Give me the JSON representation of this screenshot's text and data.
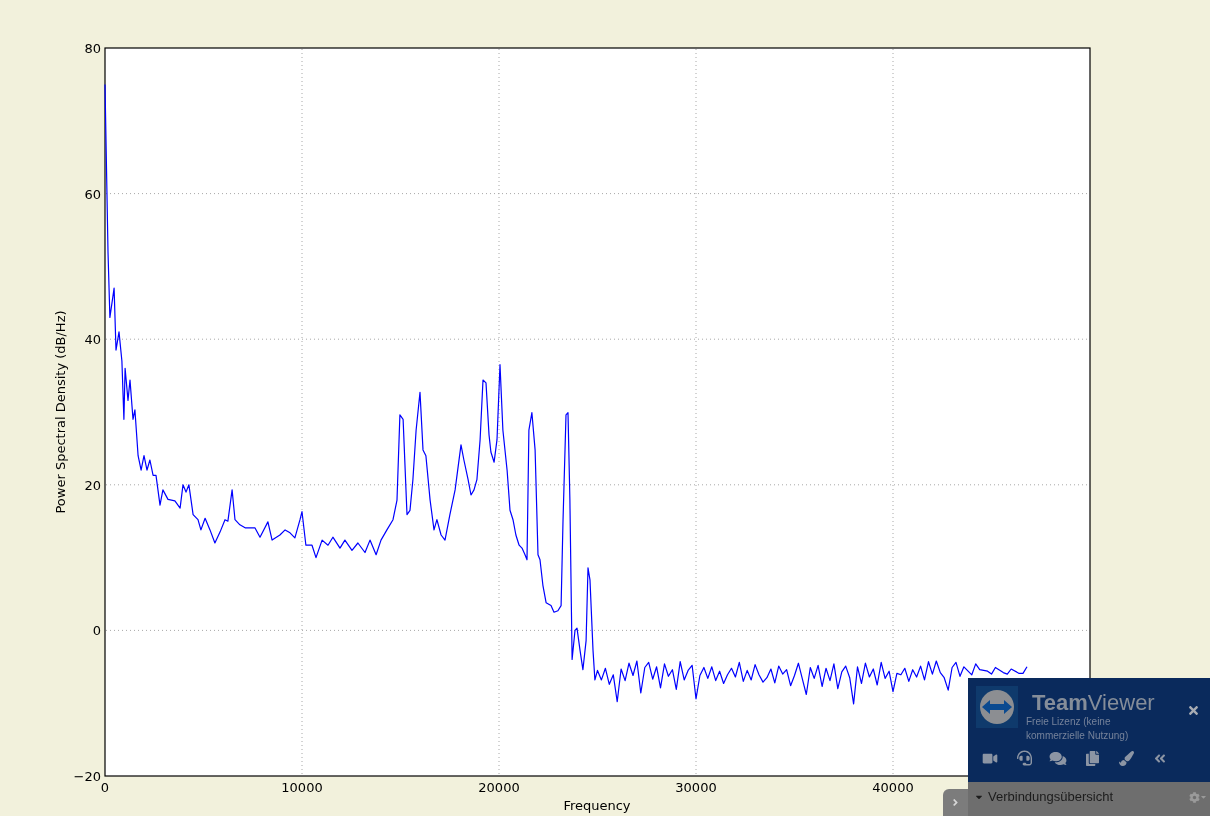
{
  "chart": {
    "chart_data": {
      "type": "line",
      "grid": true,
      "xlabel": "Frequency",
      "ylabel": "Power Spectral Density (dB/Hz)",
      "xlim": [
        0,
        50000
      ],
      "ylim": [
        -20,
        80
      ],
      "xticks": [
        0,
        10000,
        20000,
        30000,
        40000
      ],
      "yticks": [
        {
          "value": -20,
          "label": "−20"
        },
        0,
        20,
        40,
        60,
        80
      ],
      "x": [
        0,
        150,
        250,
        460,
        560,
        710,
        860,
        960,
        1020,
        1170,
        1270,
        1420,
        1520,
        1680,
        1830,
        1980,
        2130,
        2280,
        2440,
        2590,
        2790,
        2940,
        3200,
        3550,
        3810,
        3960,
        4110,
        4260,
        4470,
        4720,
        4870,
        5080,
        5330,
        5580,
        5840,
        6090,
        6240,
        6450,
        6600,
        6850,
        7110,
        7610,
        7870,
        8270,
        8480,
        8880,
        9140,
        9390,
        9640,
        9900,
        10000,
        10200,
        10510,
        10710,
        11020,
        11320,
        11570,
        11930,
        12180,
        12540,
        12840,
        13200,
        13450,
        13760,
        14010,
        14310,
        14620,
        14820,
        14970,
        15130,
        15330,
        15480,
        15630,
        15790,
        15990,
        16140,
        16290,
        16500,
        16700,
        16850,
        17060,
        17260,
        17510,
        17770,
        18070,
        18220,
        18430,
        18580,
        18730,
        18880,
        19040,
        19190,
        19340,
        19490,
        19590,
        19750,
        19900,
        20050,
        20200,
        20410,
        20560,
        20710,
        20860,
        21020,
        21170,
        21320,
        21420,
        21520,
        21670,
        21830,
        21980,
        22080,
        22230,
        22390,
        22640,
        22790,
        22990,
        23150,
        23250,
        23400,
        23500,
        23600,
        23710,
        23860,
        23960,
        24110,
        24260,
        24420,
        24520,
        24620,
        24770,
        24870,
        25000,
        25200,
        25400,
        25600,
        25800,
        26000,
        26200,
        26400,
        26600,
        26800,
        27000,
        27200,
        27400,
        27600,
        27800,
        28000,
        28200,
        28400,
        28600,
        28800,
        29000,
        29200,
        29400,
        29600,
        29800,
        30000,
        30200,
        30400,
        30600,
        30800,
        31000,
        31200,
        31400,
        31600,
        31800,
        32000,
        32200,
        32400,
        32600,
        32800,
        33000,
        33200,
        33400,
        33600,
        33800,
        34000,
        34200,
        34400,
        34600,
        34800,
        35000,
        35200,
        35400,
        35600,
        35800,
        36000,
        36200,
        36400,
        36600,
        36800,
        37000,
        37200,
        37400,
        37600,
        37800,
        38000,
        38200,
        38400,
        38600,
        38800,
        39000,
        39200,
        39400,
        39600,
        39800,
        40000,
        40200,
        40400,
        40600,
        40800,
        41000,
        41200,
        41400,
        41600,
        41800,
        42000,
        42200,
        42400,
        42600,
        42800,
        43000,
        43200,
        43400,
        43600,
        44000,
        44200,
        44400,
        44800,
        45000,
        45200,
        45600,
        45800,
        46000,
        46400,
        46600,
        46800
      ],
      "series": [
        {
          "color": "#0000ff",
          "values": [
            75,
            52,
            43,
            47,
            38.5,
            41,
            37,
            29,
            36,
            31.6,
            34.4,
            29,
            30.3,
            24,
            22,
            24,
            22,
            23.4,
            21.3,
            21.3,
            17.2,
            19.3,
            18,
            17.8,
            16.8,
            20,
            19,
            20,
            15.9,
            15.2,
            13.8,
            15.4,
            13.8,
            12,
            13.5,
            15.2,
            15,
            19.3,
            15.2,
            14.5,
            14.1,
            14.1,
            12.8,
            14.9,
            12.4,
            13.1,
            13.8,
            13.4,
            12.7,
            15.2,
            16.3,
            11.7,
            11.7,
            10,
            12.4,
            11.7,
            12.8,
            11.3,
            12.4,
            11,
            12,
            10.7,
            12.4,
            10.4,
            12.4,
            13.8,
            15.2,
            17.9,
            29.6,
            29,
            15.9,
            16.5,
            20.7,
            27.5,
            32.7,
            24.8,
            24,
            17.9,
            13.8,
            15.2,
            13.1,
            12.4,
            15.9,
            19.3,
            25.5,
            23.4,
            20.7,
            18.6,
            19.3,
            20.7,
            26.2,
            34.4,
            34,
            26.9,
            24.5,
            23.1,
            26.2,
            36.5,
            27.5,
            22,
            16.5,
            15.2,
            13.1,
            11.7,
            11.3,
            10.4,
            9.7,
            27.5,
            29.9,
            24.8,
            10.4,
            9.7,
            6.2,
            3.8,
            3.4,
            2.5,
            2.7,
            3.4,
            15,
            29.6,
            29.9,
            17.9,
            -4,
            0,
            0.3,
            -2.7,
            -5.4,
            -1.4,
            8.6,
            6.9,
            -2.7,
            -6.8,
            -5.5,
            -6.8,
            -5.2,
            -7.4,
            -6.1,
            -9.8,
            -5.3,
            -6.9,
            -4.5,
            -6.2,
            -4.2,
            -8.6,
            -5.1,
            -4.4,
            -6.7,
            -5.0,
            -7.9,
            -4.6,
            -6.3,
            -5.4,
            -8.1,
            -4.3,
            -6.8,
            -5.5,
            -4.8,
            -9.4,
            -6.2,
            -5.1,
            -6.6,
            -5.0,
            -6.9,
            -5.6,
            -7.3,
            -6.1,
            -5.2,
            -6.4,
            -4.4,
            -7.0,
            -5.5,
            -6.8,
            -4.7,
            -6.1,
            -7.1,
            -6.5,
            -5.3,
            -7.2,
            -4.9,
            -6.0,
            -5.4,
            -7.6,
            -6.2,
            -4.5,
            -6.7,
            -8.8,
            -5.1,
            -6.6,
            -4.8,
            -7.7,
            -5.2,
            -6.9,
            -4.6,
            -8.0,
            -5.7,
            -4.9,
            -6.5,
            -10.1,
            -5.0,
            -7.3,
            -4.5,
            -6.4,
            -5.3,
            -7.5,
            -4.4,
            -6.6,
            -5.6,
            -8.4,
            -5.9,
            -6.1,
            -5.2,
            -7.0,
            -5.4,
            -6.4,
            -4.9,
            -6.8,
            -4.3,
            -6.0,
            -4.2,
            -5.8,
            -6.5,
            -8.2,
            -5.1,
            -4.4,
            -6.3,
            -5.0,
            -6.1,
            -4.6,
            -5.4,
            -5.6,
            -6.0,
            -5.1,
            -5.8,
            -6.0,
            -5.3,
            -5.9,
            -5.9,
            -5.0
          ]
        }
      ]
    }
  },
  "teamviewer_panel": {
    "title": "**Team**Viewer",
    "license_note": "Freie Lizenz (keine kommerzielle Nutzung)",
    "section": {
      "label": "Verbindungsübersicht",
      "expanded": true
    }
  }
}
